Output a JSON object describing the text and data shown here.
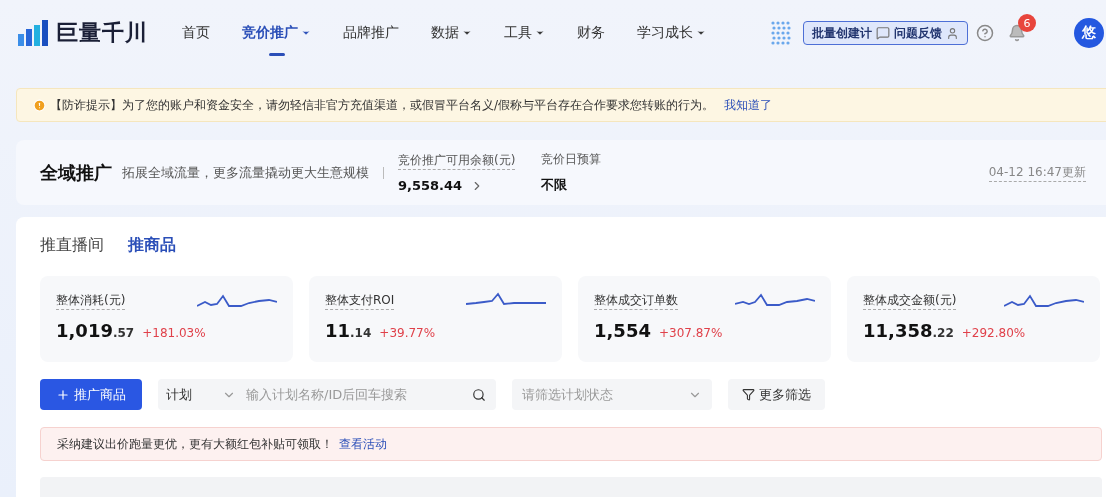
{
  "nav": {
    "logo": "巨量千川",
    "items": [
      {
        "label": "首页",
        "selected": false,
        "dropdown": false
      },
      {
        "label": "竞价推广",
        "selected": true,
        "dropdown": true
      },
      {
        "label": "品牌推广",
        "selected": false,
        "dropdown": false
      },
      {
        "label": "数据",
        "selected": false,
        "dropdown": true
      },
      {
        "label": "工具",
        "selected": false,
        "dropdown": true
      },
      {
        "label": "财务",
        "selected": false,
        "dropdown": false
      },
      {
        "label": "学习成长",
        "selected": false,
        "dropdown": true
      }
    ],
    "batch_button": "批量创建计",
    "feedback": "问题反馈",
    "notification_count": "6",
    "avatar": "悠"
  },
  "notice": {
    "text": "【防诈提示】为了您的账户和资金安全，请勿轻信非官方充值渠道，或假冒平台名义/假称与平台存在合作要求您转账的行为。",
    "link": "我知道了"
  },
  "summary": {
    "title": "全域推广",
    "subtitle": "拓展全域流量，更多流量撬动更大生意规模",
    "balance_label": "竞价推广可用余额(元)",
    "balance": "9,558.44",
    "budget_label": "竞价日预算",
    "budget": "不限",
    "updated": "04-12 16:47更新"
  },
  "tabs": [
    {
      "label": "推直播间",
      "selected": false
    },
    {
      "label": "推商品",
      "selected": true
    }
  ],
  "metrics": [
    {
      "label": "整体消耗(元)",
      "value": "1,019",
      "decimals": ".57",
      "change": "+181.03%"
    },
    {
      "label": "整体支付ROI",
      "value": "11",
      "decimals": ".14",
      "change": "+39.77%"
    },
    {
      "label": "整体成交订单数",
      "value": "1,554",
      "change": "+307.87%"
    },
    {
      "label": "整体成交金额(元)",
      "value": "11,358",
      "decimals": ".22",
      "change": "+292.80%"
    }
  ],
  "toolbar": {
    "promote_button": "推广商品",
    "plan_select": "计划",
    "search": {
      "placeholder": "输入计划名称/ID后回车搜索"
    },
    "status_select": {
      "placeholder": "请筛选计划状态"
    },
    "more_filters": "更多筛选"
  },
  "tip": {
    "text": "采纳建议出价跑量更优，更有大额红包补贴可领取！",
    "link": "查看活动"
  }
}
